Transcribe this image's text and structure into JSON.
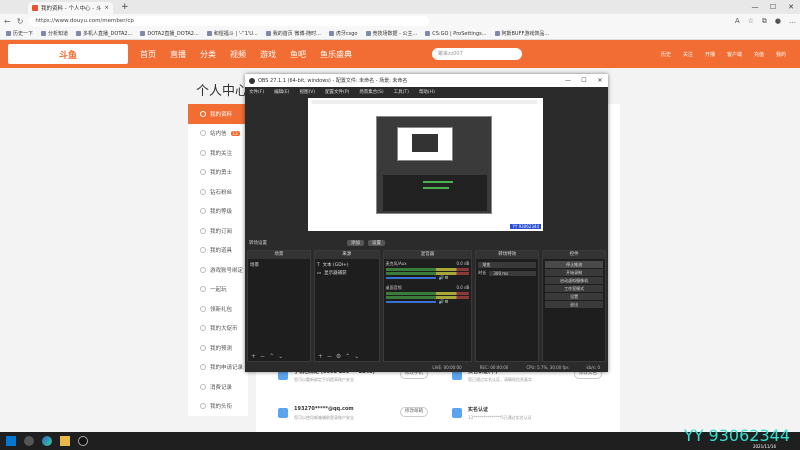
{
  "browser": {
    "tab_title": "我的资料 - 个人中心 - 斗鱼",
    "url": "https://www.douyu.com/member/cp",
    "favorites": [
      "历史一下",
      "分析知道",
      "多机人直播_DOTA2...",
      "DOTA2直播_DOTA2...",
      "和惺福斗 | '-' ̄1'U...",
      "我的首页 微博-随时...",
      "虎牙csgo",
      "竞技场数据 - 公主...",
      "CS:GO | ProSettings...",
      "阿斯BUFF游戏饰品..."
    ]
  },
  "douyu": {
    "logo": "斗鱼",
    "nav": [
      "首页",
      "直播",
      "分类",
      "视频",
      "游戏",
      "鱼吧",
      "鱼乐盛典"
    ],
    "search_placeholder": "聚来zz007",
    "right": [
      "历史",
      "关注",
      "开播",
      "客户端",
      "充值",
      "我的"
    ]
  },
  "page": {
    "title": "个人中心",
    "sidebar": [
      {
        "label": "我的资料",
        "active": true
      },
      {
        "label": "站内信",
        "badge": "13"
      },
      {
        "label": "我的关注"
      },
      {
        "label": "我的勇士"
      },
      {
        "label": "钻石粉丝"
      },
      {
        "label": "我的等级"
      },
      {
        "label": "我的订阅"
      },
      {
        "label": "我的道具"
      },
      {
        "label": "游戏账号绑定"
      },
      {
        "label": "一起玩"
      },
      {
        "label": "领新礼包"
      },
      {
        "label": "我的大促币"
      },
      {
        "label": "我的预测"
      },
      {
        "label": "我的申请记录"
      },
      {
        "label": "消费记录"
      },
      {
        "label": "我的头衔"
      }
    ],
    "cards": [
      {
        "t1": "手机已绑定 (0098 156*** 2145)",
        "t2": "您可以重新绑定手机提高账户安全",
        "btn": "修改手机"
      },
      {
        "t1": "实名认证(中)",
        "t2": "您已通过实名认证，请确保信息真实",
        "btn": "修改实名"
      },
      {
        "t1": "193270*****@qq.com",
        "t2": "您可以使用邮箱辅助登录账户安全",
        "btn": "修改邮箱"
      },
      {
        "t1": "实名认证",
        "t2": "13**************5已通过实名认证",
        "btn": ""
      }
    ]
  },
  "obs": {
    "title": "OBS 27.1.1 (64-bit, windows) - 配置文件: 未命名 - 场景: 未命名",
    "menu": [
      "文件(F)",
      "编辑(E)",
      "视图(V)",
      "配置文件(P)",
      "场景集合(S)",
      "工具(T)",
      "帮助(H)"
    ],
    "transition_label": "转场设置",
    "transition_buttons": [
      "添加",
      "设置"
    ],
    "docks": {
      "scenes": "场景",
      "sources": "来源",
      "mixer": "混音器",
      "transitions": "转场特效",
      "controls": "控件"
    },
    "scene_items": [
      "场景"
    ],
    "source_items": [
      "文本 (GDI+)",
      "显示器捕获"
    ],
    "mixer_items": [
      {
        "name": "麦克风/Aux",
        "db": "0.0 dB"
      },
      {
        "name": "桌面音频",
        "db": "0.0 dB"
      }
    ],
    "transition_props": {
      "type": "渐变",
      "duration_label": "时长",
      "duration": "300 ms"
    },
    "controls": [
      "停止推流",
      "开始录制",
      "启动虚拟摄像机",
      "工作室模式",
      "设置",
      "退出"
    ],
    "status": [
      "LIVE: 00:00:00",
      "REC: 00:00:00",
      "CPU: 5.7%, 30.00 fps",
      "kb/s: 0"
    ]
  },
  "watermark": "YY 93062344",
  "clock": "2021/11/16"
}
